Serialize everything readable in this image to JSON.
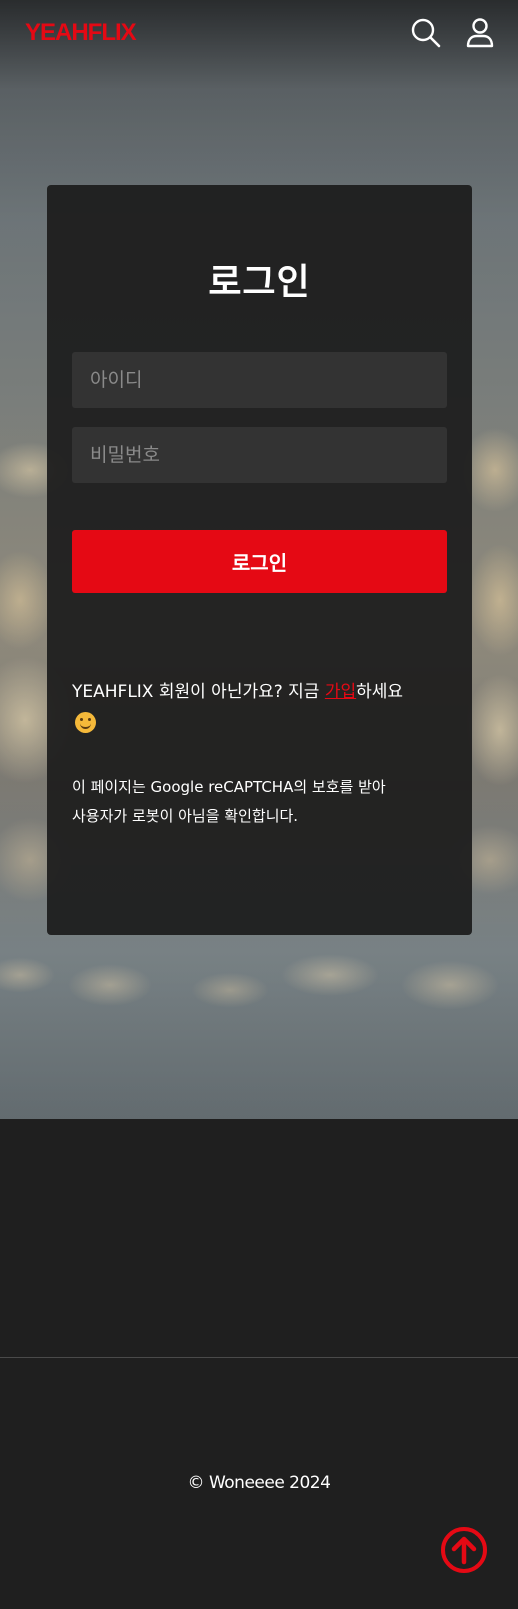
{
  "brand": {
    "logo": "YEAHFLIX",
    "accent": "#e50914"
  },
  "header": {
    "icons": [
      "search-icon",
      "user-icon"
    ]
  },
  "login": {
    "title": "로그인",
    "id_placeholder": "아이디",
    "password_placeholder": "비밀번호",
    "submit_label": "로그인",
    "signup_prefix": "YEAHFLIX 회원이 아닌가요? 지금 ",
    "signup_link": "가입",
    "signup_suffix": "하세요",
    "recaptcha_line1": "이 페이지는 Google reCAPTCHA의 보호를 받아",
    "recaptcha_line2": "사용자가 로봇이 아님을 확인합니다."
  },
  "footer": {
    "copyright": "© Woneeee 2024"
  },
  "scroll_top": {
    "icon": "arrow-up-circle-icon"
  }
}
